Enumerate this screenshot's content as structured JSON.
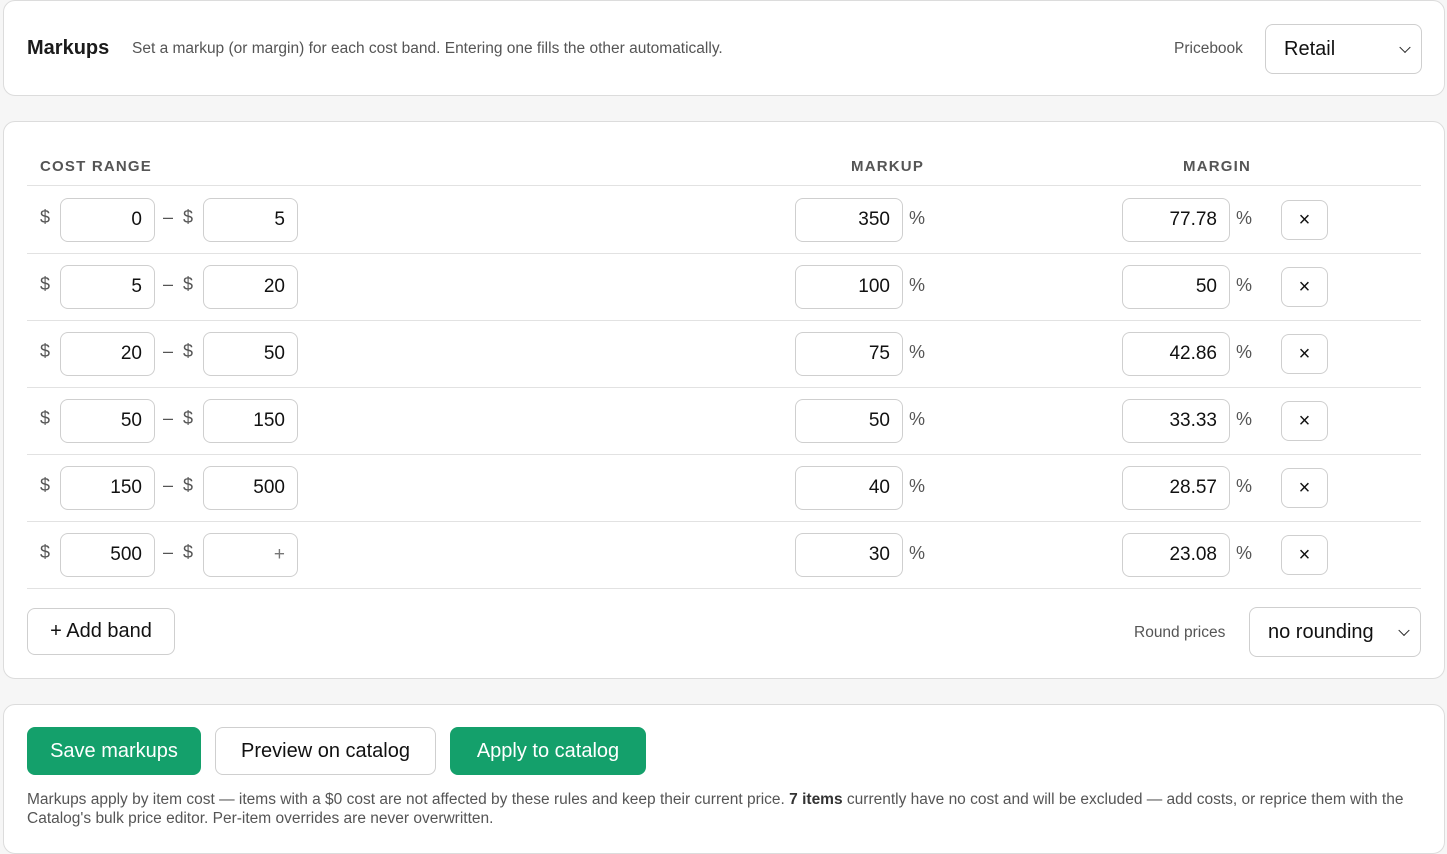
{
  "header": {
    "title": "Markups",
    "description": "Set a markup (or margin) for each cost band. Entering one fills the other automatically.",
    "pricebook_label": "Pricebook",
    "pricebook_value": "Retail"
  },
  "table": {
    "columns": {
      "cost_range": "COST RANGE",
      "markup": "MARKUP",
      "margin": "MARGIN"
    },
    "currency_symbol": "$",
    "range_separator": "–",
    "percent_symbol": "%",
    "remove_icon": "×",
    "open_ended_placeholder": "+",
    "bands": [
      {
        "from": "0",
        "to": "5",
        "markup": "350",
        "margin": "77.78"
      },
      {
        "from": "5",
        "to": "20",
        "markup": "100",
        "margin": "50"
      },
      {
        "from": "20",
        "to": "50",
        "markup": "75",
        "margin": "42.86"
      },
      {
        "from": "50",
        "to": "150",
        "markup": "50",
        "margin": "33.33"
      },
      {
        "from": "150",
        "to": "500",
        "markup": "40",
        "margin": "28.57"
      },
      {
        "from": "500",
        "to": "",
        "markup": "30",
        "margin": "23.08"
      }
    ]
  },
  "add_band_label": "+ Add band",
  "rounding": {
    "label": "Round prices",
    "value": "no rounding"
  },
  "actions": {
    "save_label": "Save markups",
    "preview_label": "Preview on catalog",
    "apply_label": "Apply to catalog"
  },
  "footnote": {
    "before": "Markups apply by item cost — items with a $0 cost are not affected by these rules and keep their current price.",
    "count_bold": "7 items",
    "after": "currently have no cost and will be excluded — add costs, or reprice them with the Catalog's bulk price editor. Per-item overrides are never overwritten."
  },
  "colors": {
    "primary": "#14a06b",
    "muted_text": "#555555",
    "border": "#cfcfcf"
  }
}
